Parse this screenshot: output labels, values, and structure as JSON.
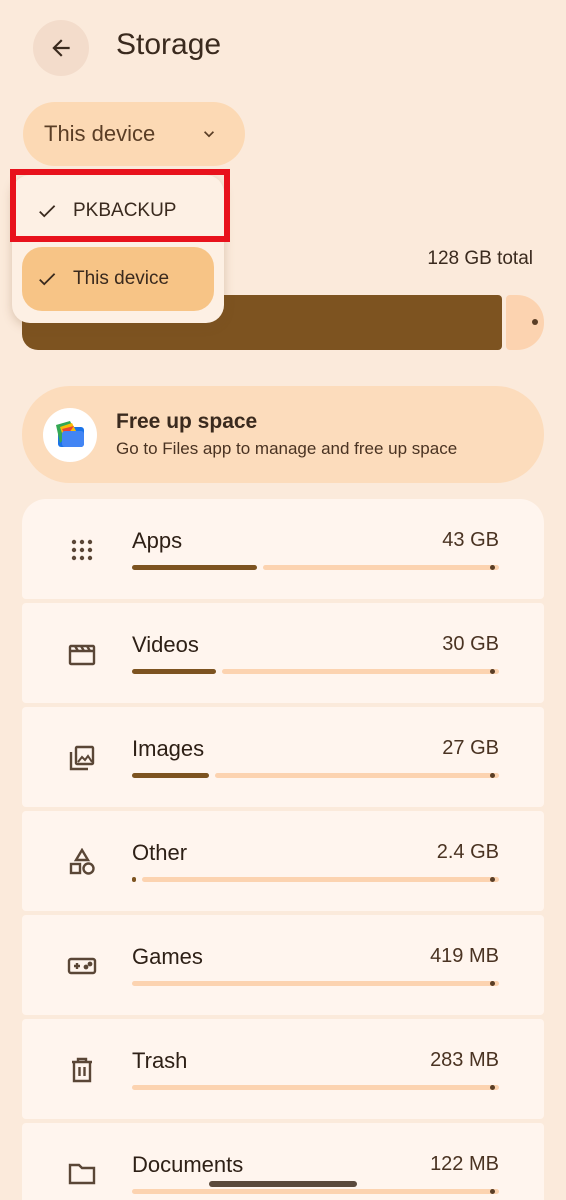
{
  "header": {
    "title": "Storage"
  },
  "device_select": {
    "label": "This device"
  },
  "menu": {
    "items": [
      {
        "label": "PKBACKUP",
        "checked": true
      },
      {
        "label": "This device",
        "checked": true,
        "selected": true
      }
    ]
  },
  "storage": {
    "total": "128 GB total",
    "used_fraction": 0.92
  },
  "free_card": {
    "title": "Free up space",
    "subtitle": "Go to Files app to manage and free up space"
  },
  "categories": [
    {
      "name": "Apps",
      "size": "43 GB",
      "fraction": 0.34,
      "icon": "apps-grid-icon"
    },
    {
      "name": "Videos",
      "size": "30 GB",
      "fraction": 0.23,
      "icon": "movie-clapper-icon"
    },
    {
      "name": "Images",
      "size": "27 GB",
      "fraction": 0.21,
      "icon": "photo-library-icon"
    },
    {
      "name": "Other",
      "size": "2.4 GB",
      "fraction": 0.01,
      "icon": "shapes-icon"
    },
    {
      "name": "Games",
      "size": "419 MB",
      "fraction": 0.0,
      "icon": "gamepad-icon"
    },
    {
      "name": "Trash",
      "size": "283 MB",
      "fraction": 0.0,
      "icon": "trash-icon"
    },
    {
      "name": "Documents",
      "size": "122 MB",
      "fraction": 0.0,
      "icon": "folder-icon"
    }
  ],
  "colors": {
    "background": "#fbeadb",
    "accent": "#7d5320",
    "highlight_border": "#e8121c"
  }
}
